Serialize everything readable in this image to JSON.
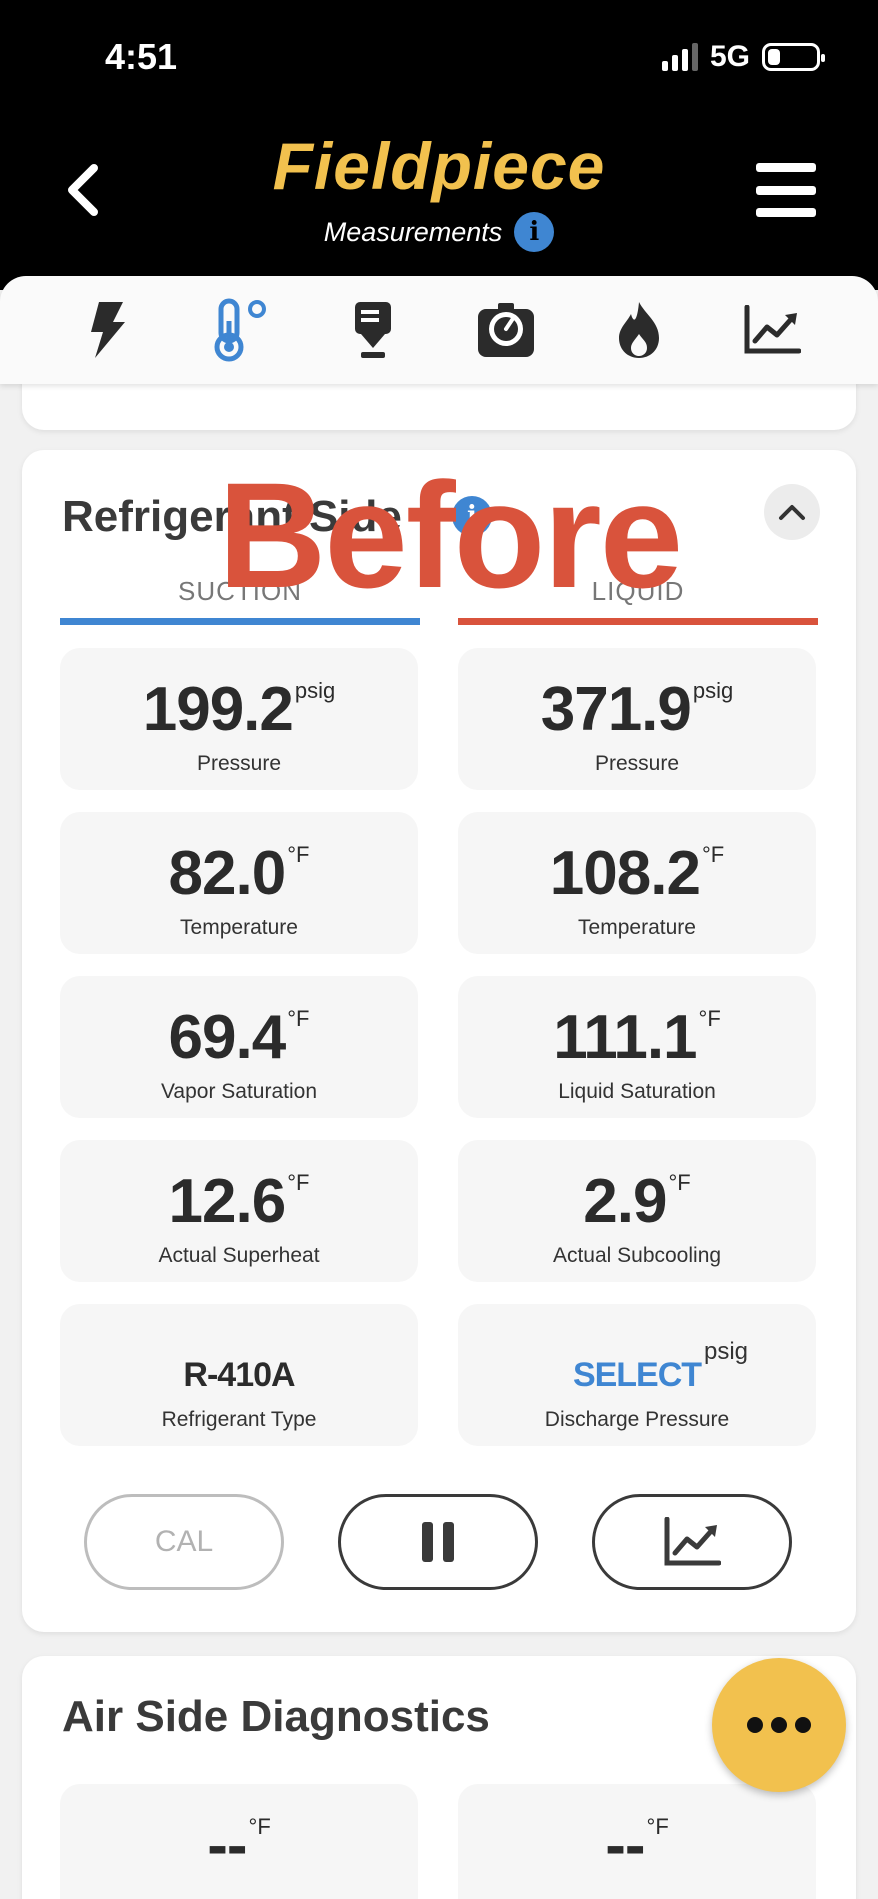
{
  "status": {
    "time": "4:51",
    "network": "5G"
  },
  "header": {
    "logo": "Fieldpiece",
    "subtitle": "Measurements",
    "info": "i"
  },
  "tabs": [
    "electrical-icon",
    "temperature-icon",
    "download-icon",
    "gauge-icon",
    "flame-icon",
    "chart-icon"
  ],
  "card": {
    "title": "Refrigerant Side",
    "info": "i",
    "suction_header": "SUCTION",
    "liquid_header": "LIQUID",
    "suction": [
      {
        "value": "199.2",
        "unit": "psig",
        "label": "Pressure"
      },
      {
        "value": "82.0",
        "unit": "°F",
        "label": "Temperature"
      },
      {
        "value": "69.4",
        "unit": "°F",
        "label": "Vapor Saturation"
      },
      {
        "value": "12.6",
        "unit": "°F",
        "label": "Actual Superheat"
      },
      {
        "value": "R-410A",
        "unit": "",
        "label": "Refrigerant Type"
      }
    ],
    "liquid": [
      {
        "value": "371.9",
        "unit": "psig",
        "label": "Pressure"
      },
      {
        "value": "108.2",
        "unit": "°F",
        "label": "Temperature"
      },
      {
        "value": "111.1",
        "unit": "°F",
        "label": "Liquid Saturation"
      },
      {
        "value": "2.9",
        "unit": "°F",
        "label": "Actual Subcooling"
      },
      {
        "value": "SELECT",
        "unit": "psig",
        "label": "Discharge Pressure"
      }
    ],
    "buttons": {
      "cal": "CAL"
    },
    "colors": {
      "suction": "#3f86d2",
      "liquid": "#d9533c"
    }
  },
  "watermark": "Before",
  "air": {
    "title": "Air Side Diagnostics",
    "left": {
      "value": "--",
      "unit": "°F"
    },
    "right": {
      "value": "--",
      "unit": "°F"
    }
  }
}
